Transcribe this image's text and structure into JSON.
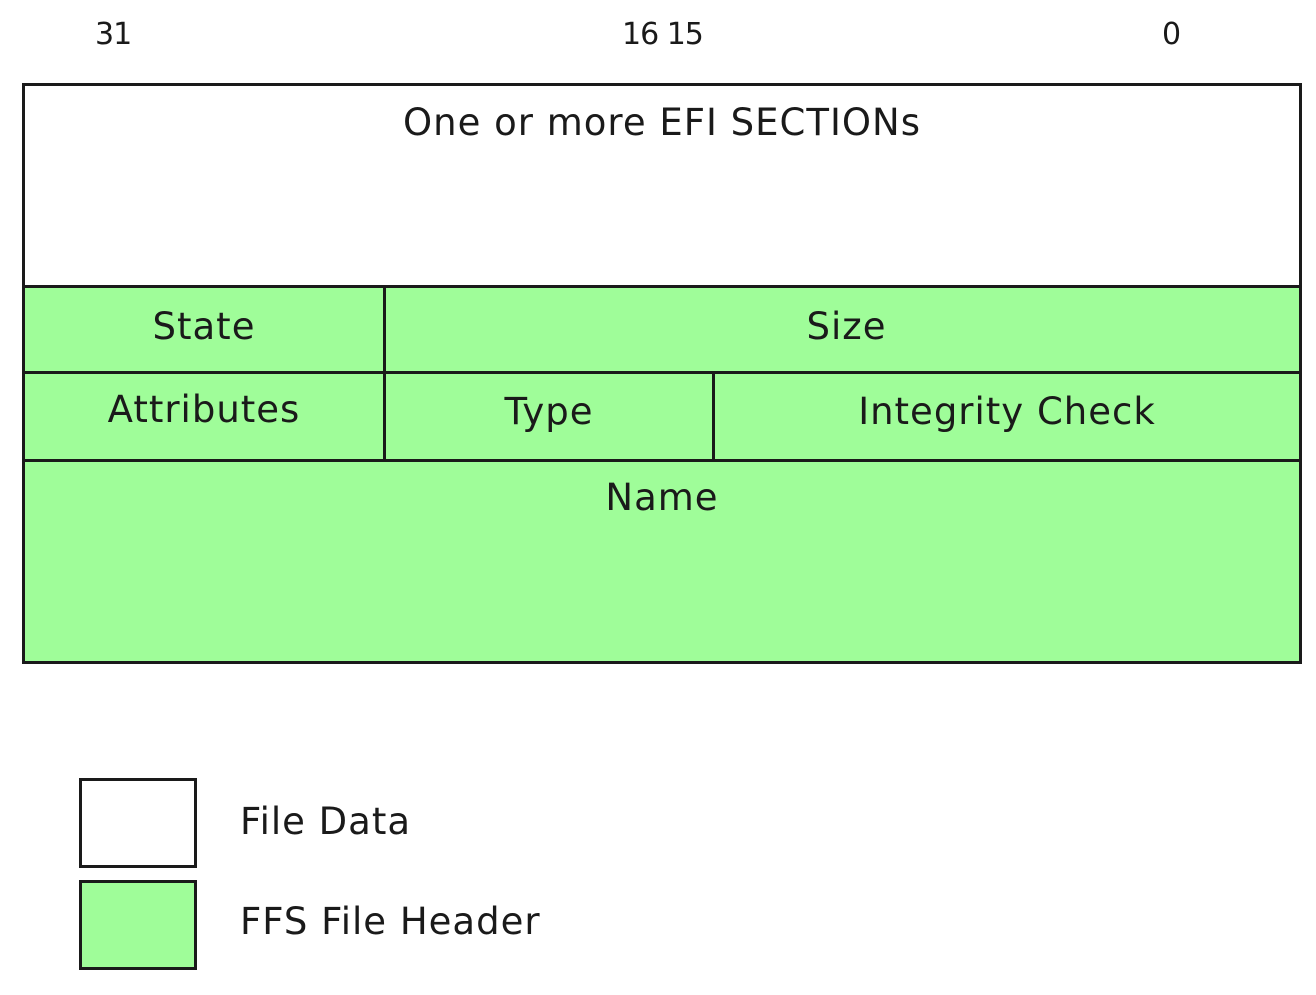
{
  "bit_positions": {
    "high": "31",
    "middle": "16 15",
    "low": "0"
  },
  "fields": {
    "sections": "One or more EFI SECTIONs",
    "state": "State",
    "size": "Size",
    "attributes": "Attributes",
    "type": "Type",
    "integrity_check": "Integrity Check",
    "name": "Name"
  },
  "legend": {
    "file_data": "File Data",
    "ffs_file_header": "FFS File Header"
  },
  "colors": {
    "file_data": "#ffffff",
    "ffs_file_header": "#9ffd99",
    "border": "#1a1a1a"
  }
}
